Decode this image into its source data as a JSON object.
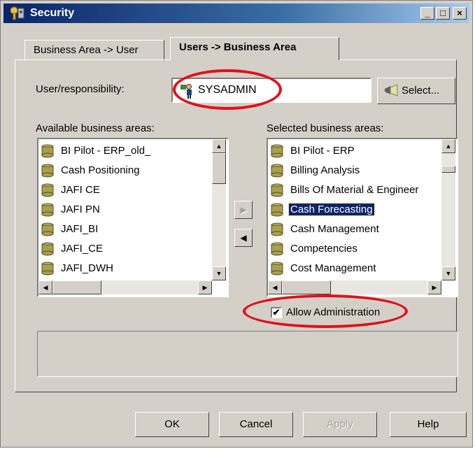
{
  "window": {
    "title": "Security",
    "controls": [
      "_",
      "□",
      "×"
    ]
  },
  "tabs": [
    {
      "label": "Business Area -> User",
      "active": false
    },
    {
      "label": "Users -> Business Area",
      "active": true
    }
  ],
  "user_field": {
    "label": "User/responsibility:",
    "value": "SYSADMIN",
    "select_button": "Select..."
  },
  "available": {
    "label": "Available business areas:",
    "items": [
      "BI Pilot - ERP_old_",
      "Cash Positioning",
      "JAFI CE",
      "JAFI PN",
      "JAFI_BI",
      "JAFI_CE",
      "JAFI_DWH"
    ]
  },
  "selected": {
    "label": "Selected business areas:",
    "items": [
      "BI Pilot - ERP",
      "Billing Analysis",
      "Bills Of Material & Engineer",
      "Cash Forecasting",
      "Cash Management",
      "Competencies",
      "Cost Management"
    ],
    "highlighted_index": 3
  },
  "move_buttons": {
    "add": "▶",
    "remove": "◀"
  },
  "allow_admin": {
    "label": "Allow Administration",
    "checked": true
  },
  "buttons": {
    "ok": "OK",
    "cancel": "Cancel",
    "apply": "Apply",
    "help": "Help"
  },
  "colors": {
    "highlight": "#0a246a",
    "annotation": "#e0101a",
    "face": "#d4d0c8"
  }
}
